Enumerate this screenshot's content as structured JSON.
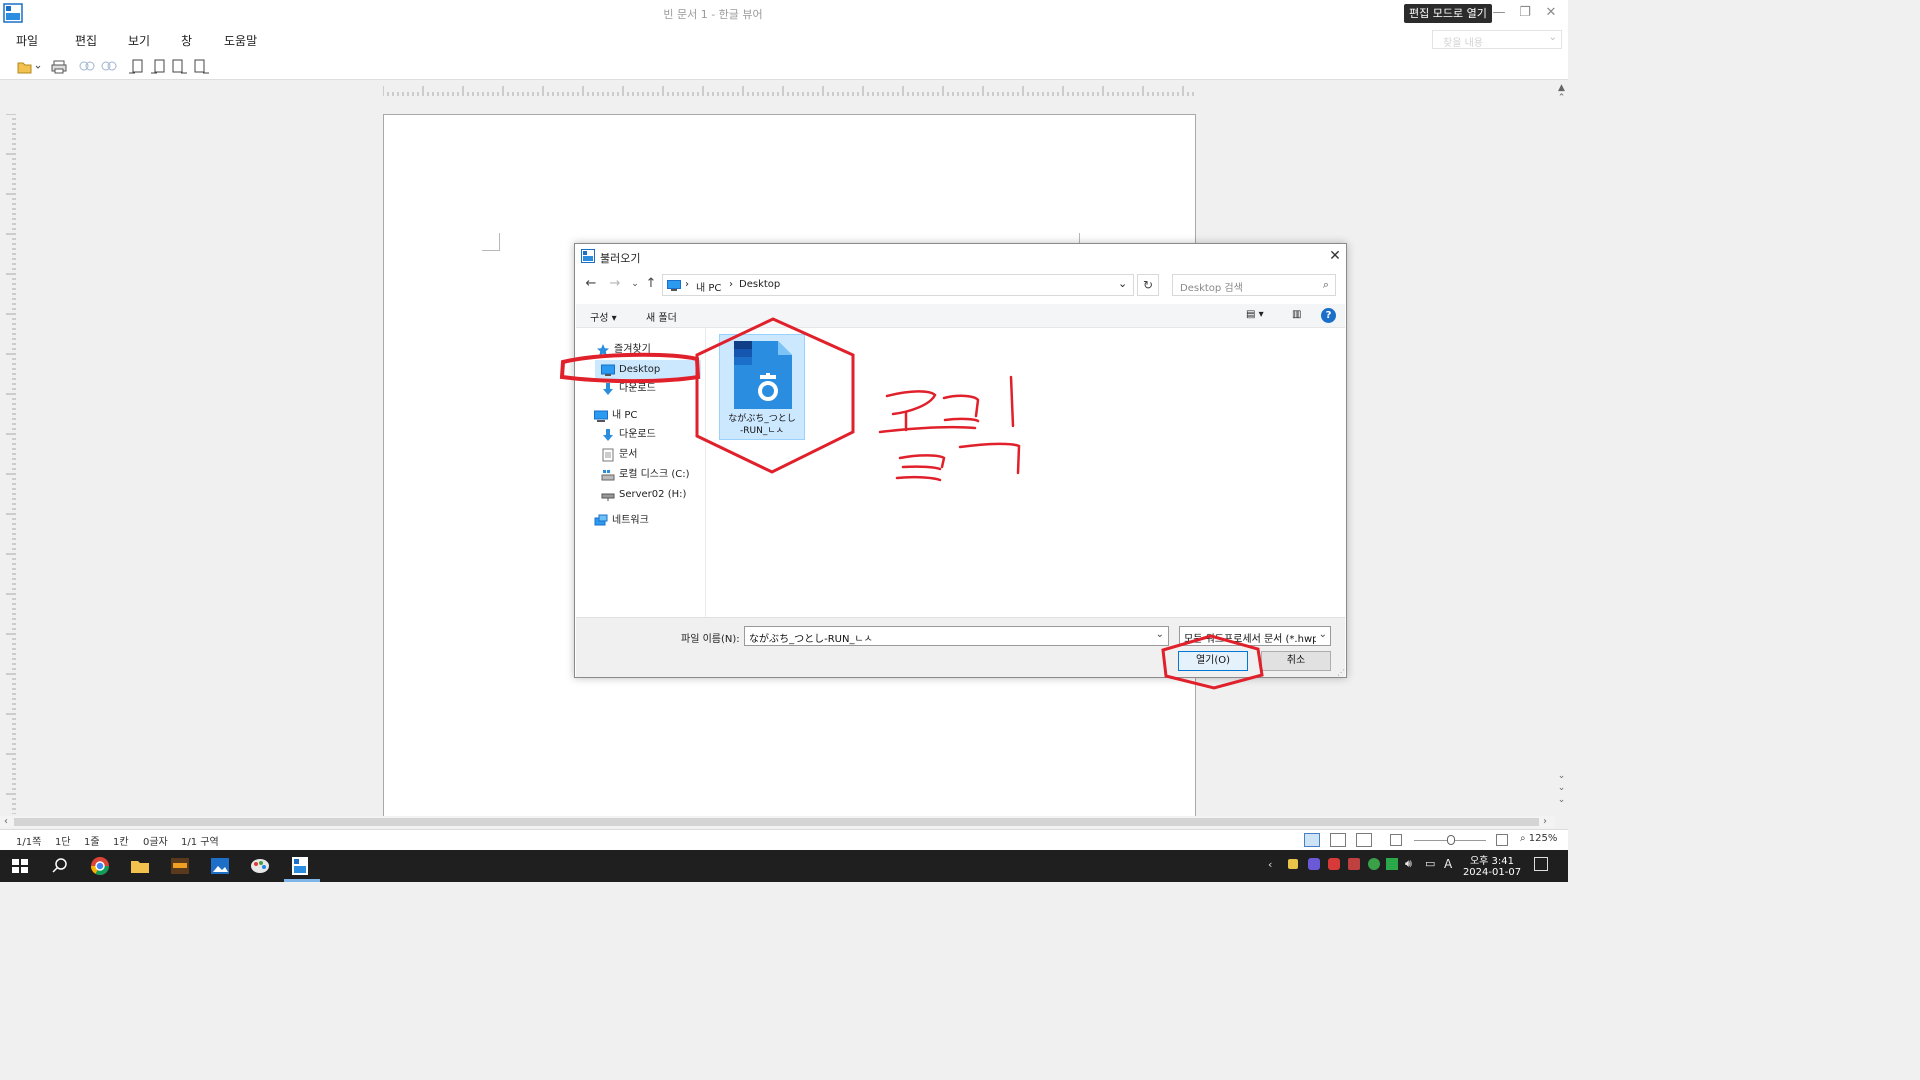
{
  "app": {
    "window_title": "빈 문서 1 - 한글 뷰어",
    "edit_mode_label": "편집 모드로 열기",
    "search_placeholder": "찾을 내용"
  },
  "menu": [
    "파일",
    "편집",
    "보기",
    "창",
    "도움말"
  ],
  "status": {
    "page": "1/1쪽",
    "column": "1단",
    "line": "1줄",
    "col": "1칸",
    "chars": "0글자",
    "section": "1/1 구역",
    "zoom": "125%"
  },
  "dialog": {
    "title": "불러오기",
    "breadcrumb": [
      "내 PC",
      "Desktop"
    ],
    "search_placeholder": "Desktop 검색",
    "commands": {
      "organize": "구성 ▾",
      "new_folder": "새 폴더"
    },
    "nav": [
      {
        "label": "즐겨찾기",
        "icon": "star-icon"
      },
      {
        "label": "Desktop",
        "icon": "desktop-icon"
      },
      {
        "label": "다운로드",
        "icon": "download-icon"
      },
      {
        "label": "내 PC",
        "icon": "pc-icon"
      },
      {
        "label": "다운로드",
        "icon": "download-icon"
      },
      {
        "label": "문서",
        "icon": "document-icon"
      },
      {
        "label": "로컬 디스크 (C:)",
        "icon": "drive-icon"
      },
      {
        "label": "Server02 (H:)",
        "icon": "network-drive-icon"
      },
      {
        "label": "네트워크",
        "icon": "network-icon"
      }
    ],
    "file": {
      "name_line1": "ながぶち_つとし",
      "name_line2": "-RUN_ㄴㅅ",
      "icon": "hwp-file-icon"
    },
    "filename_label": "파일 이름(N):",
    "filename_value": "ながぶち_つとし-RUN_ㄴㅅ",
    "filter": "모든 워드프로세서 문서 (*.hwp",
    "open_label": "열기(O)",
    "cancel_label": "취소"
  },
  "annotation_text": "클릭",
  "clock": {
    "time": "오후 3:41",
    "date": "2024-01-07"
  },
  "colors": {
    "annotation_red": "#e0202a",
    "accent_blue": "#0078d7",
    "selection_blue": "#cce8ff",
    "taskbar": "#1f1f1f"
  }
}
